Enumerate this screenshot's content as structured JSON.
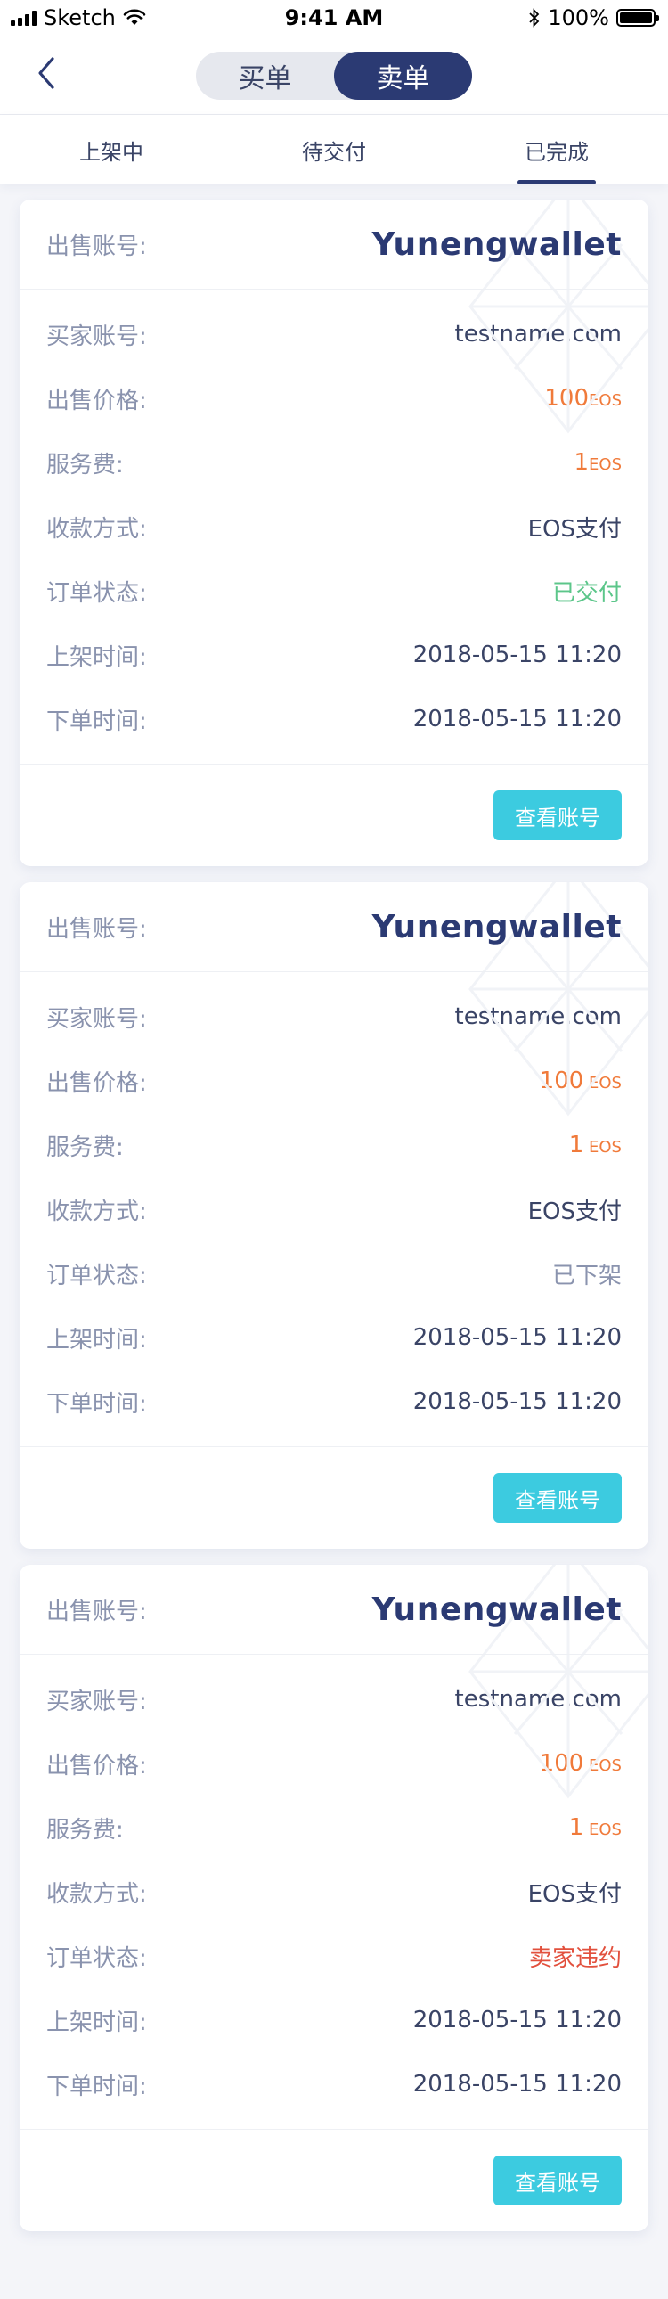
{
  "status_bar": {
    "carrier": "Sketch",
    "time": "9:41 AM",
    "battery": "100%"
  },
  "nav": {
    "segments": [
      "买单",
      "卖单"
    ],
    "active_segment": 1
  },
  "tabs": [
    {
      "label": "上架中"
    },
    {
      "label": "待交付"
    },
    {
      "label": "已完成"
    }
  ],
  "active_tab": 2,
  "labels": {
    "sell_account": "出售账号:",
    "buyer_account": "买家账号:",
    "price": "出售价格:",
    "fee": "服务费:",
    "payment": "收款方式:",
    "status": "订单状态:",
    "listed_time": "上架时间:",
    "order_time": "下单时间:"
  },
  "orders": [
    {
      "sell_account": "Yunengwallet",
      "buyer_account": "testname.com",
      "price": "100",
      "price_unit": "EOS",
      "fee": "1",
      "fee_unit": "EOS",
      "payment": "EOS支付",
      "status": "已交付",
      "status_color": "#5cc68a",
      "listed_time": "2018-05-15 11:20",
      "order_time": "2018-05-15 11:20",
      "button": "查看账号"
    },
    {
      "sell_account": "Yunengwallet",
      "buyer_account": "testname.com",
      "price": "100",
      "price_unit": " EOS",
      "fee": "1",
      "fee_unit": " EOS",
      "payment": "EOS支付",
      "status": "已下架",
      "status_color": "#8a93ae",
      "listed_time": "2018-05-15 11:20",
      "order_time": "2018-05-15 11:20",
      "button": "查看账号"
    },
    {
      "sell_account": "Yunengwallet",
      "buyer_account": "testname.com",
      "price": "100",
      "price_unit": " EOS",
      "fee": "1",
      "fee_unit": " EOS",
      "payment": "EOS支付",
      "status": "卖家违约",
      "status_color": "#e2503d",
      "listed_time": "2018-05-15 11:20",
      "order_time": "2018-05-15 11:20",
      "button": "查看账号"
    }
  ],
  "colors": {
    "primary": "#2b3a73",
    "accent_button": "#3ccbe0",
    "price_orange": "#f07a3a"
  }
}
